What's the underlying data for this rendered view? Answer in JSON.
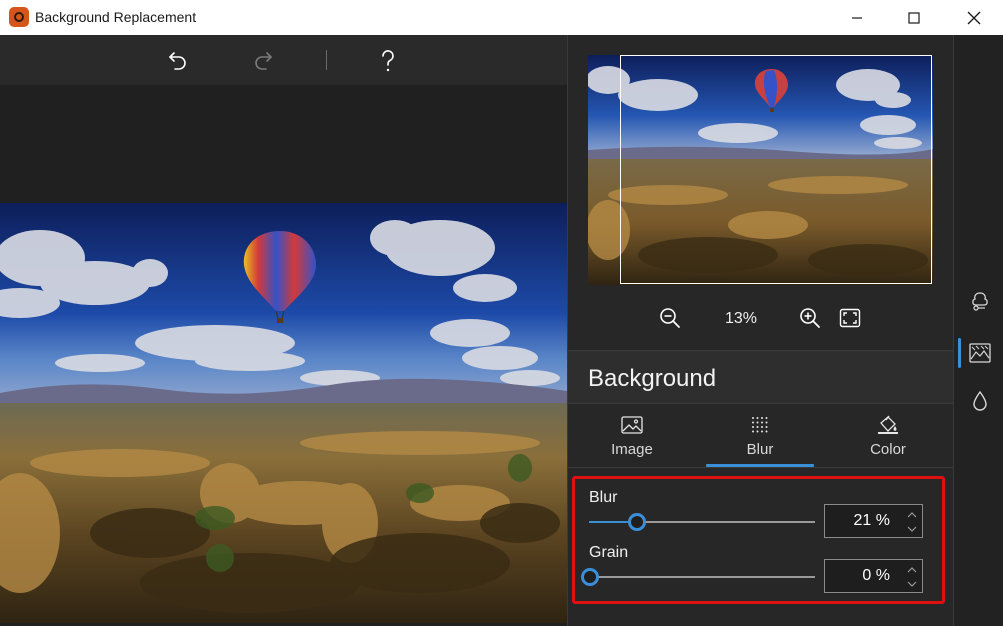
{
  "window": {
    "title": "Background Replacement"
  },
  "canvas": {
    "image_subject": "hot air balloon over rocky valley"
  },
  "preview": {
    "zoom_level": "13%"
  },
  "section": {
    "title": "Background"
  },
  "tabs": [
    {
      "label": "Image",
      "icon": "image-icon"
    },
    {
      "label": "Blur",
      "icon": "blur-dots-icon"
    },
    {
      "label": "Color",
      "icon": "paint-bucket-icon"
    }
  ],
  "active_tab": "Blur",
  "sliders": {
    "blur": {
      "label": "Blur",
      "value_text": "21 %",
      "value": 21
    },
    "grain": {
      "label": "Grain",
      "value_text": "0 %",
      "value": 0
    }
  },
  "rail": {
    "items": [
      "subject-shape-icon",
      "background-landscape-icon",
      "color-drop-icon"
    ],
    "active_index": 1
  },
  "colors": {
    "accent": "#3a8fd9",
    "highlight_box": "#e01010"
  }
}
